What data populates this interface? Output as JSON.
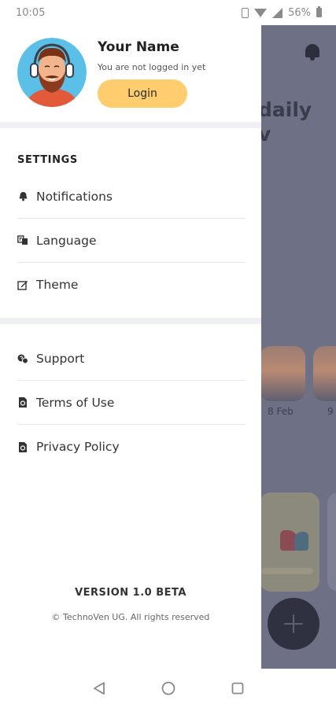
{
  "status_bar": {
    "time": "10:05",
    "battery": "56%",
    "icons": [
      "vibrate-icon",
      "wifi-icon",
      "signal-icon",
      "battery-icon"
    ]
  },
  "drawer": {
    "profile": {
      "name": "Your Name",
      "subtitle": "You are not logged in yet",
      "login_label": "Login"
    },
    "settings": {
      "title": "SETTINGS",
      "items": [
        {
          "label": "Notifications",
          "icon": "bell-icon"
        },
        {
          "label": "Language",
          "icon": "translate-icon"
        },
        {
          "label": "Theme",
          "icon": "edit-theme-icon"
        }
      ]
    },
    "info": {
      "items": [
        {
          "label": "Support",
          "icon": "support-icon"
        },
        {
          "label": "Terms of Use",
          "icon": "document-icon"
        },
        {
          "label": "Privacy Policy",
          "icon": "document-icon"
        }
      ]
    },
    "footer": {
      "version": "VERSION 1.0 BETA",
      "copyright": "© TechnoVen UG. All rights reserved"
    }
  },
  "background": {
    "title_lines": [
      "daily",
      "v"
    ],
    "dates": [
      "8 Feb",
      "9"
    ]
  },
  "colors": {
    "accent": "#ffcd6d",
    "overlay": "#6e7085",
    "separator": "#eff0f4"
  },
  "nav": {
    "buttons": [
      "back-icon",
      "home-icon",
      "recents-icon"
    ]
  }
}
